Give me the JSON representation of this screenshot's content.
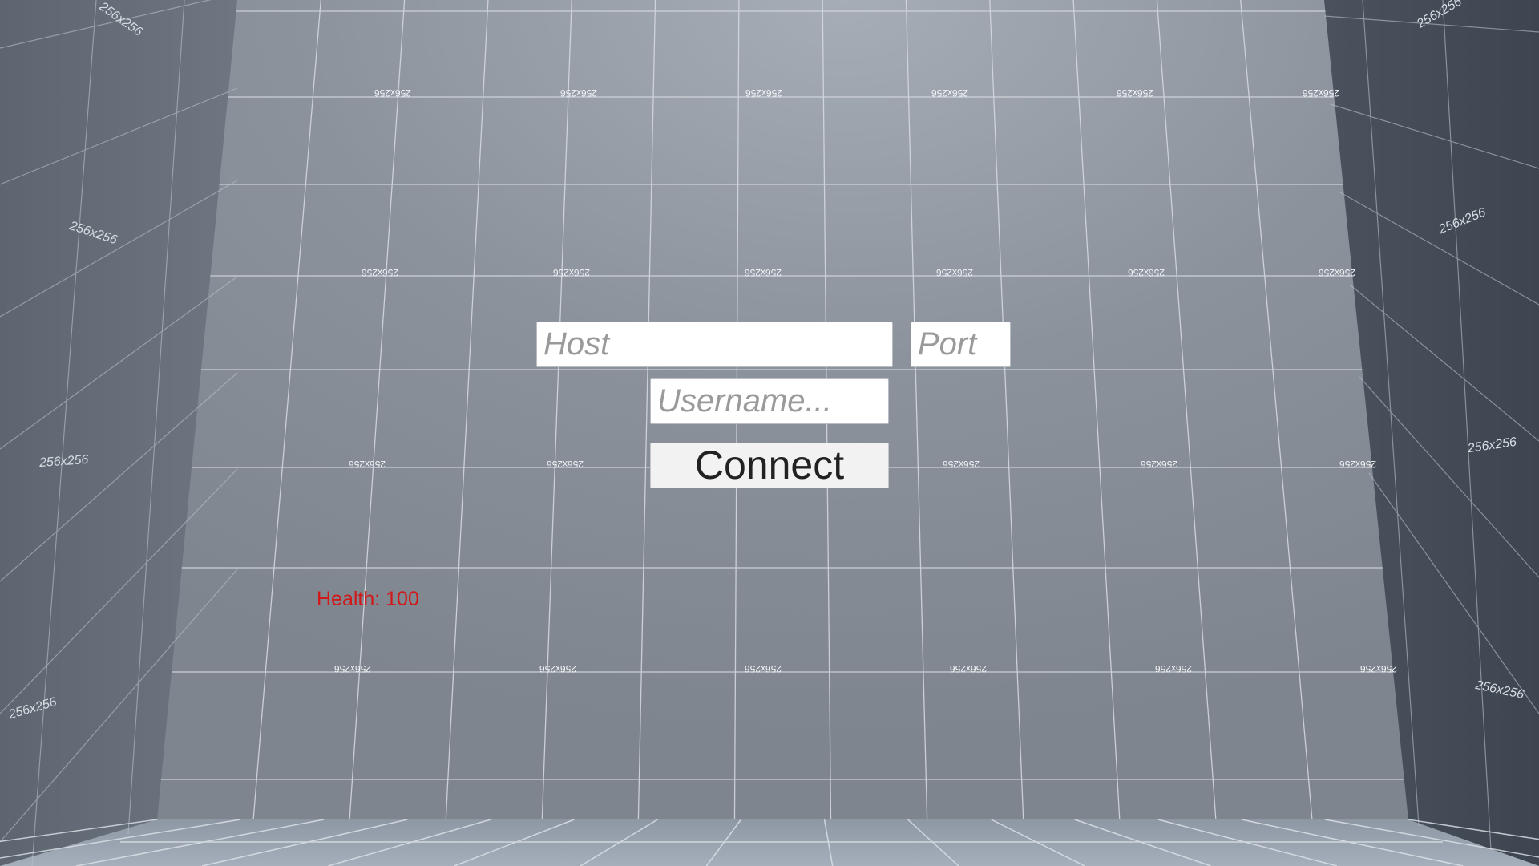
{
  "connect_form": {
    "host_placeholder": "Host",
    "port_placeholder": "Port",
    "username_placeholder": "Username...",
    "connect_label": "Connect"
  },
  "hud": {
    "health_text": "Health: 100",
    "health_color": "#d01818"
  },
  "environment": {
    "texture_label": "256x256",
    "wall_color": "#878e98",
    "side_wall_color": "#454d58",
    "grid_line_color": "#d8dce2"
  }
}
